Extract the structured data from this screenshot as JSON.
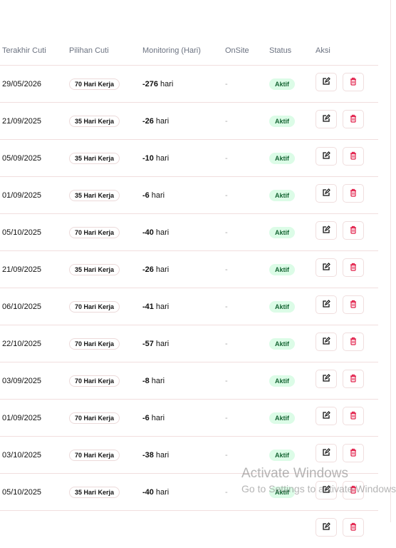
{
  "columns": [
    "Terakhir Cuti",
    "Pilihan Cuti",
    "Monitoring (Hari)",
    "OnSite",
    "Status",
    "Aksi"
  ],
  "unit": "hari",
  "rows": [
    {
      "date": "29/05/2026",
      "option": "70 Hari Kerja",
      "monitoring": "-276",
      "onsite": "-",
      "status": "Aktif"
    },
    {
      "date": "21/09/2025",
      "option": "35 Hari Kerja",
      "monitoring": "-26",
      "onsite": "-",
      "status": "Aktif"
    },
    {
      "date": "05/09/2025",
      "option": "35 Hari Kerja",
      "monitoring": "-10",
      "onsite": "-",
      "status": "Aktif"
    },
    {
      "date": "01/09/2025",
      "option": "35 Hari Kerja",
      "monitoring": "-6",
      "onsite": "-",
      "status": "Aktif"
    },
    {
      "date": "05/10/2025",
      "option": "70 Hari Kerja",
      "monitoring": "-40",
      "onsite": "-",
      "status": "Aktif"
    },
    {
      "date": "21/09/2025",
      "option": "35 Hari Kerja",
      "monitoring": "-26",
      "onsite": "-",
      "status": "Aktif"
    },
    {
      "date": "06/10/2025",
      "option": "70 Hari Kerja",
      "monitoring": "-41",
      "onsite": "-",
      "status": "Aktif"
    },
    {
      "date": "22/10/2025",
      "option": "70 Hari Kerja",
      "monitoring": "-57",
      "onsite": "-",
      "status": "Aktif"
    },
    {
      "date": "03/09/2025",
      "option": "70 Hari Kerja",
      "monitoring": "-8",
      "onsite": "-",
      "status": "Aktif"
    },
    {
      "date": "01/09/2025",
      "option": "70 Hari Kerja",
      "monitoring": "-6",
      "onsite": "-",
      "status": "Aktif"
    },
    {
      "date": "03/10/2025",
      "option": "70 Hari Kerja",
      "monitoring": "-38",
      "onsite": "-",
      "status": "Aktif"
    },
    {
      "date": "05/10/2025",
      "option": "35 Hari Kerja",
      "monitoring": "-40",
      "onsite": "-",
      "status": "Aktif"
    }
  ],
  "watermark": {
    "title": "Activate Windows",
    "subtitle": "Go to Settings to activate Windows."
  }
}
